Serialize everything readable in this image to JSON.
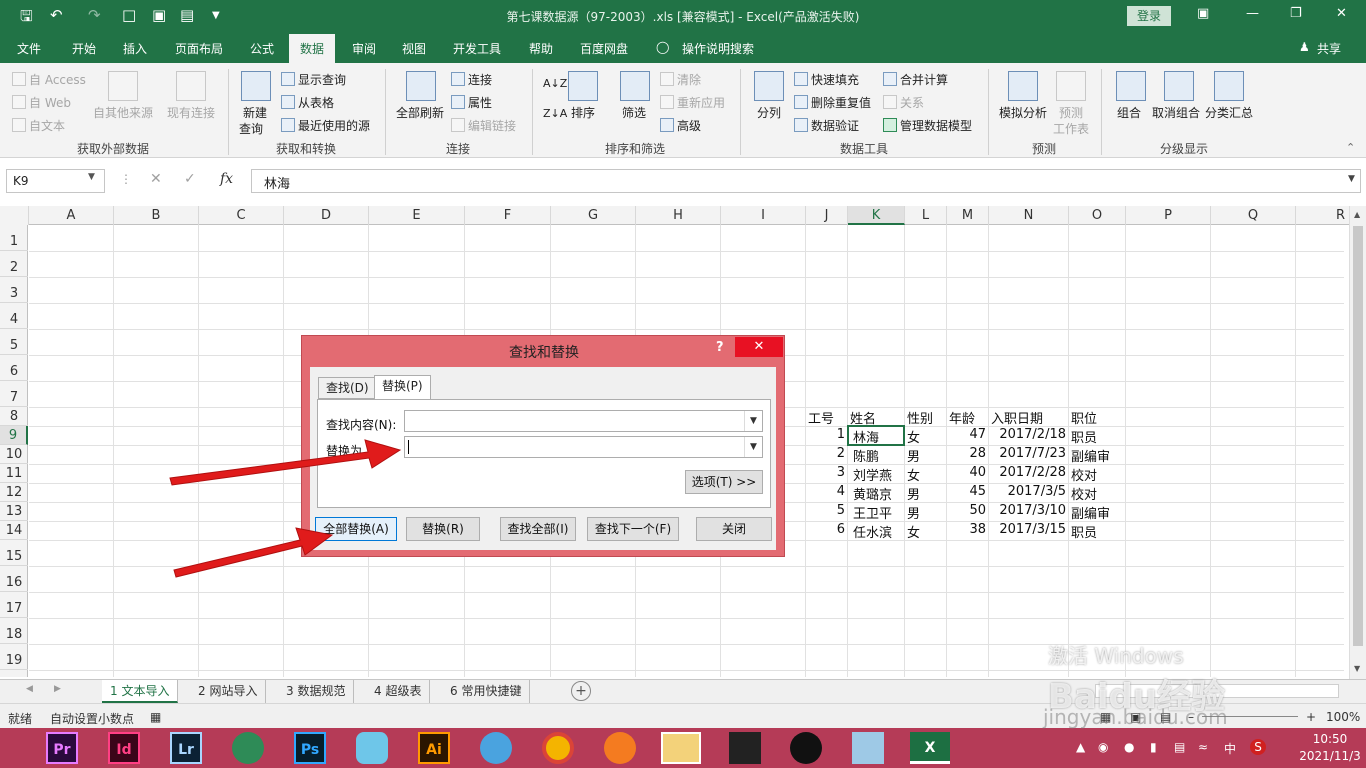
{
  "window": {
    "title": "第七课数据源（97-2003）.xls  [兼容模式]  -  Excel(产品激活失败)",
    "login": "登录",
    "share": "共享"
  },
  "ribbon_tabs": [
    "文件",
    "开始",
    "插入",
    "页面布局",
    "公式",
    "数据",
    "审阅",
    "视图",
    "开发工具",
    "帮助",
    "百度网盘",
    "操作说明搜索"
  ],
  "active_tab": "数据",
  "ribbon": {
    "external": {
      "access": "自 Access",
      "web": "自 Web",
      "text": "自文本",
      "other": "自其他来源",
      "existing": "现有连接",
      "label": "获取外部数据"
    },
    "transform": {
      "new_query_1": "新建",
      "new_query_2": "查询",
      "show_query": "显示查询",
      "from_table": "从表格",
      "recent": "最近使用的源",
      "label": "获取和转换"
    },
    "connections": {
      "refresh": "全部刷新",
      "connect": "连接",
      "props": "属性",
      "edit_links": "编辑链接",
      "label": "连接"
    },
    "sort": {
      "sort": "排序",
      "filter": "筛选",
      "clear": "清除",
      "reapply": "重新应用",
      "advanced": "高级",
      "label": "排序和筛选"
    },
    "tools": {
      "split": "分列",
      "flash": "快速填充",
      "remove_dup": "删除重复值",
      "validate": "数据验证",
      "consolidate": "合并计算",
      "relations": "关系",
      "model": "管理数据模型",
      "label": "数据工具"
    },
    "forecast": {
      "whatif": "模拟分析",
      "sheet_1": "预测",
      "sheet_2": "工作表",
      "label": "预测"
    },
    "outline": {
      "group": "组合",
      "ungroup": "取消组合",
      "subtotal": "分类汇总",
      "label": "分级显示"
    }
  },
  "formula_bar": {
    "name_box": "K9",
    "fx": "fx",
    "content": "林海"
  },
  "columns": [
    "A",
    "B",
    "C",
    "D",
    "E",
    "F",
    "G",
    "H",
    "I",
    "J",
    "K",
    "L",
    "M",
    "N",
    "O",
    "P",
    "Q",
    "R"
  ],
  "rows": [
    "1",
    "2",
    "3",
    "4",
    "5",
    "6",
    "7",
    "8",
    "9",
    "10",
    "11",
    "12",
    "13",
    "14",
    "15",
    "16",
    "17",
    "18",
    "19"
  ],
  "table": {
    "headers": [
      "工号",
      "姓名",
      "性别",
      "年龄",
      "入职日期",
      "职位"
    ],
    "rows": [
      [
        "1",
        "林海",
        "女",
        "47",
        "2017/2/18",
        "职员"
      ],
      [
        "2",
        "陈鹏",
        "男",
        "28",
        "2017/7/23",
        "副编审"
      ],
      [
        "3",
        "刘学燕",
        "女",
        "40",
        "2017/2/28",
        "校对"
      ],
      [
        "4",
        "黄璐京",
        "男",
        "45",
        "2017/3/5",
        "校对"
      ],
      [
        "5",
        "王卫平",
        "男",
        "50",
        "2017/3/10",
        "副编审"
      ],
      [
        "6",
        "任水滨",
        "女",
        "38",
        "2017/3/15",
        "职员"
      ]
    ]
  },
  "dialog": {
    "title": "查找和替换",
    "help": "?",
    "close": "✕",
    "tab_find": "查找(D)",
    "tab_replace": "替换(P)",
    "find_label": "查找内容(N):",
    "find_value": "",
    "replace_label": "替换为",
    "replace_value": "",
    "options": "选项(T) >>",
    "replace_all": "全部替换(A)",
    "replace": "替换(R)",
    "find_all": "查找全部(I)",
    "find_next": "查找下一个(F)",
    "close_btn": "关闭"
  },
  "sheets": [
    "1 文本导入",
    "2 网站导入",
    "3 数据规范",
    "4 超级表",
    "6 常用快捷键"
  ],
  "active_sheet": "1 文本导入",
  "status": {
    "ready": "就绪",
    "auto_decimal": "自动设置小数点",
    "zoom": "100%"
  },
  "taskbar": {
    "apps": [
      "Pr",
      "Id",
      "Lr",
      "Ps",
      "Ai"
    ],
    "ime": "中",
    "time": "10:50",
    "date": "2021/11/3"
  },
  "watermark": {
    "line1": "激活 Windows",
    "line2": "Baidu经验",
    "line3": "jingyan.baidu.com"
  },
  "colors": {
    "excel_green": "#217346",
    "dialog_border": "#e36b72",
    "taskbar": "#b53b57",
    "arrow": "#e01b1b"
  }
}
